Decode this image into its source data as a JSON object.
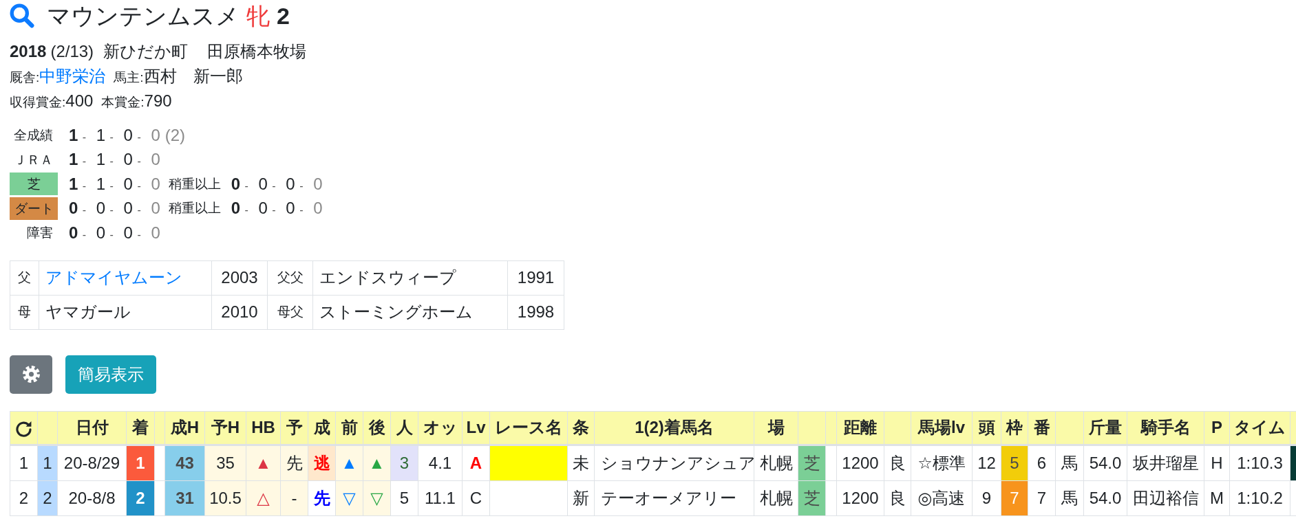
{
  "header": {
    "name": "マウンテンムスメ",
    "sex": "牝",
    "age": "2"
  },
  "profile": {
    "birth_year": "2018",
    "birth_date": "(2/13)",
    "birthplace": "新ひだか町",
    "breeder": "田原橋本牧場",
    "trainer_label": "厩舎:",
    "trainer": "中野栄治",
    "owner_label": "馬主:",
    "owner": "西村　新一郎",
    "earned_label": "収得賞金:",
    "earned": "400",
    "prize_label": "本賞金:",
    "prize": "790"
  },
  "records": [
    {
      "label": "全成績",
      "counts": "1 - 1 - 0 - 0",
      "total": "(2)"
    },
    {
      "label": "ＪＲＡ",
      "counts": "1 - 1 - 0 - 0"
    },
    {
      "label": "芝",
      "color": "#7bcf96",
      "counts": "1 - 1 - 0 - 0",
      "condition": "稍重以上",
      "condition_counts": "0 - 0 - 0 - 0"
    },
    {
      "label": "ダート",
      "color": "#d48945",
      "counts": "0 - 0 - 0 - 0",
      "condition": "稍重以上",
      "condition_counts": "0 - 0 - 0 - 0"
    },
    {
      "label": "障害",
      "counts": "0 - 0 - 0 - 0"
    }
  ],
  "pedigree": [
    {
      "relation": "父",
      "name": "アドマイヤムーン",
      "link": true,
      "year": "2003",
      "grand_relation": "父父",
      "grand_name": "エンドスウィープ",
      "grand_year": "1991"
    },
    {
      "relation": "母",
      "name": "ヤマガール",
      "link": false,
      "year": "2010",
      "grand_relation": "母父",
      "grand_name": "ストーミングホーム",
      "grand_year": "1998"
    }
  ],
  "toolbar": {
    "view_button": "簡易表示"
  },
  "table": {
    "columns": [
      {
        "kind": "icon"
      },
      {
        "kind": "blank"
      },
      {
        "kind": "text",
        "label": "日付"
      },
      {
        "kind": "text",
        "label": "着"
      },
      {
        "kind": "blank"
      },
      {
        "kind": "text",
        "label": "成H"
      },
      {
        "kind": "text",
        "label": "予H"
      },
      {
        "kind": "text",
        "label": "HB"
      },
      {
        "kind": "text",
        "label": "予"
      },
      {
        "kind": "text",
        "label": "成"
      },
      {
        "kind": "text",
        "label": "前"
      },
      {
        "kind": "text",
        "label": "後"
      },
      {
        "kind": "text",
        "label": "人"
      },
      {
        "kind": "text",
        "label": "オッ"
      },
      {
        "kind": "text",
        "label": "Lv"
      },
      {
        "kind": "text",
        "label": "レース名"
      },
      {
        "kind": "text",
        "label": "条"
      },
      {
        "kind": "text",
        "label": "1(2)着馬名"
      },
      {
        "kind": "text",
        "label": "場"
      },
      {
        "kind": "blank"
      },
      {
        "kind": "blank"
      },
      {
        "kind": "text",
        "label": "距離"
      },
      {
        "kind": "blank"
      },
      {
        "kind": "text",
        "label": "馬場lv"
      },
      {
        "kind": "text",
        "label": "頭"
      },
      {
        "kind": "text",
        "label": "枠"
      },
      {
        "kind": "text",
        "label": "番"
      },
      {
        "kind": "blank"
      },
      {
        "kind": "text",
        "label": "斤量"
      },
      {
        "kind": "text",
        "label": "騎手名"
      },
      {
        "kind": "text",
        "label": "P"
      },
      {
        "kind": "text",
        "label": "タイム"
      },
      {
        "kind": "blank"
      }
    ],
    "rows": [
      {
        "cells": [
          {
            "text": "1",
            "bold": false
          },
          {
            "text": "1",
            "bold": false,
            "color": "#b8daff"
          },
          {
            "text": "20-8/29",
            "bold": false
          },
          {
            "text": "1",
            "bold": true,
            "color": "#fb5a3c"
          },
          {},
          {
            "text": "43",
            "bold": true,
            "color": "#87ceeb"
          },
          {
            "text": "35",
            "bold": false,
            "color": "#fff9e3"
          },
          {
            "text": "▲",
            "color": "#fff9e3",
            "ink": {
              "color": "#dc3545"
            }
          },
          {
            "text": "先",
            "bold": false,
            "color": "#fff9e3"
          },
          {
            "text": "逃",
            "bold": true,
            "color": "#ffe8cc",
            "ink": {
              "color": "#ff0000"
            }
          },
          {
            "text": "▲",
            "color": "#fff9e3",
            "ink": {
              "color": "#007bff"
            }
          },
          {
            "text": "▲",
            "color": "#fff9e3",
            "ink": {
              "color": "#28a745"
            }
          },
          {
            "text": "3",
            "bold": false,
            "color": "#e2e2fa",
            "ink": {
              "color": "#2e6b36"
            }
          },
          {
            "text": "4.1",
            "bold": false
          },
          {
            "text": "A",
            "bold": true,
            "ink": {
              "color": "#ff0000"
            }
          },
          {
            "color": "#ffff00"
          },
          {
            "text": "未",
            "bold": false
          },
          {
            "text": "ショウナンアシュア",
            "bold": false
          },
          {
            "text": "札幌",
            "bold": false
          },
          {
            "text": "芝",
            "bold": false,
            "color": "#7bcf96"
          },
          {},
          {
            "text": "1200",
            "bold": false
          },
          {
            "text": "良",
            "bold": false
          },
          {
            "text": "☆標準",
            "bold": false
          },
          {
            "text": "12",
            "bold": false
          },
          {
            "text": "5",
            "bold": false,
            "color": "#f2cd0a"
          },
          {
            "text": "6",
            "bold": false
          },
          {
            "text": "馬",
            "bold": false
          },
          {
            "text": "54.0",
            "bold": false
          },
          {
            "text": "坂井瑠星",
            "bold": false
          },
          {
            "text": "H",
            "bold": false
          },
          {
            "text": "1:10.3",
            "bold": false
          },
          {
            "color": "#073b35"
          }
        ]
      },
      {
        "cells": [
          {
            "text": "2",
            "bold": false
          },
          {
            "text": "2",
            "bold": false,
            "color": "#b8daff"
          },
          {
            "text": "20-8/8",
            "bold": false
          },
          {
            "text": "2",
            "bold": true,
            "color": "#2192c8"
          },
          {},
          {
            "text": "31",
            "bold": true,
            "color": "#87ceeb"
          },
          {
            "text": "10.5",
            "bold": false,
            "color": "#fff9e3"
          },
          {
            "text": "△",
            "color": "#fff9e3",
            "ink": {
              "color": "#dc3545"
            }
          },
          {
            "text": "-",
            "bold": false,
            "color": "#fff9e3"
          },
          {
            "text": "先",
            "bold": true,
            "ink": {
              "color": "#0000ff"
            }
          },
          {
            "text": "▽",
            "color": "#fff9e3",
            "ink": {
              "color": "#007bff"
            }
          },
          {
            "text": "▽",
            "color": "#fff9e3",
            "ink": {
              "color": "#28a745"
            }
          },
          {
            "text": "5",
            "bold": false
          },
          {
            "text": "11.1",
            "bold": false
          },
          {
            "text": "C",
            "bold": false
          },
          {},
          {
            "text": "新",
            "bold": false
          },
          {
            "text": "テーオーメアリー",
            "bold": false
          },
          {
            "text": "札幌",
            "bold": false
          },
          {
            "text": "芝",
            "bold": false,
            "color": "#7bcf96"
          },
          {},
          {
            "text": "1200",
            "bold": false
          },
          {
            "text": "良",
            "bold": false
          },
          {
            "text": "◎高速",
            "bold": false
          },
          {
            "text": "9",
            "bold": false
          },
          {
            "text": "7",
            "bold": false,
            "color": "#f7941d"
          },
          {
            "text": "7",
            "bold": false
          },
          {
            "text": "馬",
            "bold": false
          },
          {
            "text": "54.0",
            "bold": false
          },
          {
            "text": "田辺裕信",
            "bold": false
          },
          {
            "text": "M",
            "bold": false
          },
          {
            "text": "1:10.2",
            "bold": false
          },
          {}
        ]
      }
    ]
  }
}
